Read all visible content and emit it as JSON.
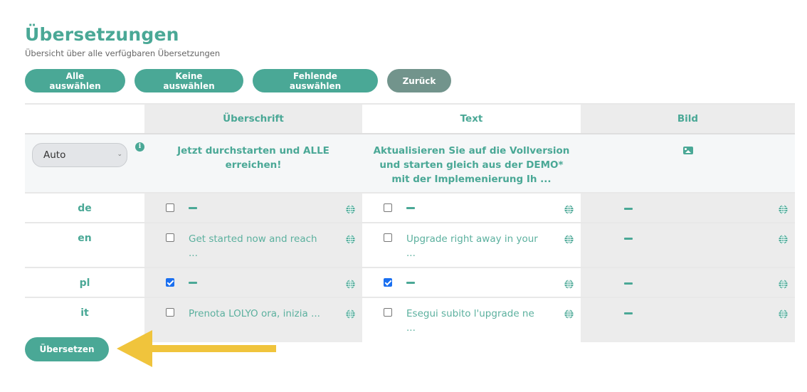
{
  "header": {
    "title": "Übersetzungen",
    "subtitle": "Übersicht über alle verfügbaren Übersetzungen"
  },
  "toolbar": {
    "select_all": "Alle auswählen",
    "select_none": "Keine auswählen",
    "select_missing": "Fehlende auswählen",
    "back": "Zurück"
  },
  "table": {
    "columns": [
      "Überschrift",
      "Text",
      "Bild"
    ],
    "source": {
      "mode_select": "Auto",
      "info_icon": "info-icon",
      "heading": "Jetzt durchstarten und ALLE erreichen!",
      "text": "Aktualisieren Sie auf die Vollversion und starten gleich aus der DEMO* mit der Implemenierung Ih ...",
      "image_icon": "image-icon"
    },
    "rows": [
      {
        "lang": "de",
        "heading": {
          "checked": false,
          "value": ""
        },
        "text": {
          "checked": false,
          "value": ""
        },
        "bild": {
          "value": ""
        }
      },
      {
        "lang": "en",
        "heading": {
          "checked": false,
          "value": "Get started now and reach ..."
        },
        "text": {
          "checked": false,
          "value": "Upgrade right away in your ..."
        },
        "bild": {
          "value": ""
        }
      },
      {
        "lang": "pl",
        "heading": {
          "checked": true,
          "value": ""
        },
        "text": {
          "checked": true,
          "value": ""
        },
        "bild": {
          "value": ""
        }
      },
      {
        "lang": "it",
        "heading": {
          "checked": false,
          "value": "Prenota LOLYO ora, inizia ..."
        },
        "text": {
          "checked": false,
          "value": "Esegui subito l'upgrade ne ..."
        },
        "bild": {
          "value": ""
        }
      }
    ]
  },
  "footer": {
    "translate": "Übersetzen"
  },
  "colors": {
    "accent": "#4aa896",
    "back_button": "#72948c",
    "annotation_arrow": "#f0c43c",
    "checkbox_checked": "#1a6ff0"
  }
}
